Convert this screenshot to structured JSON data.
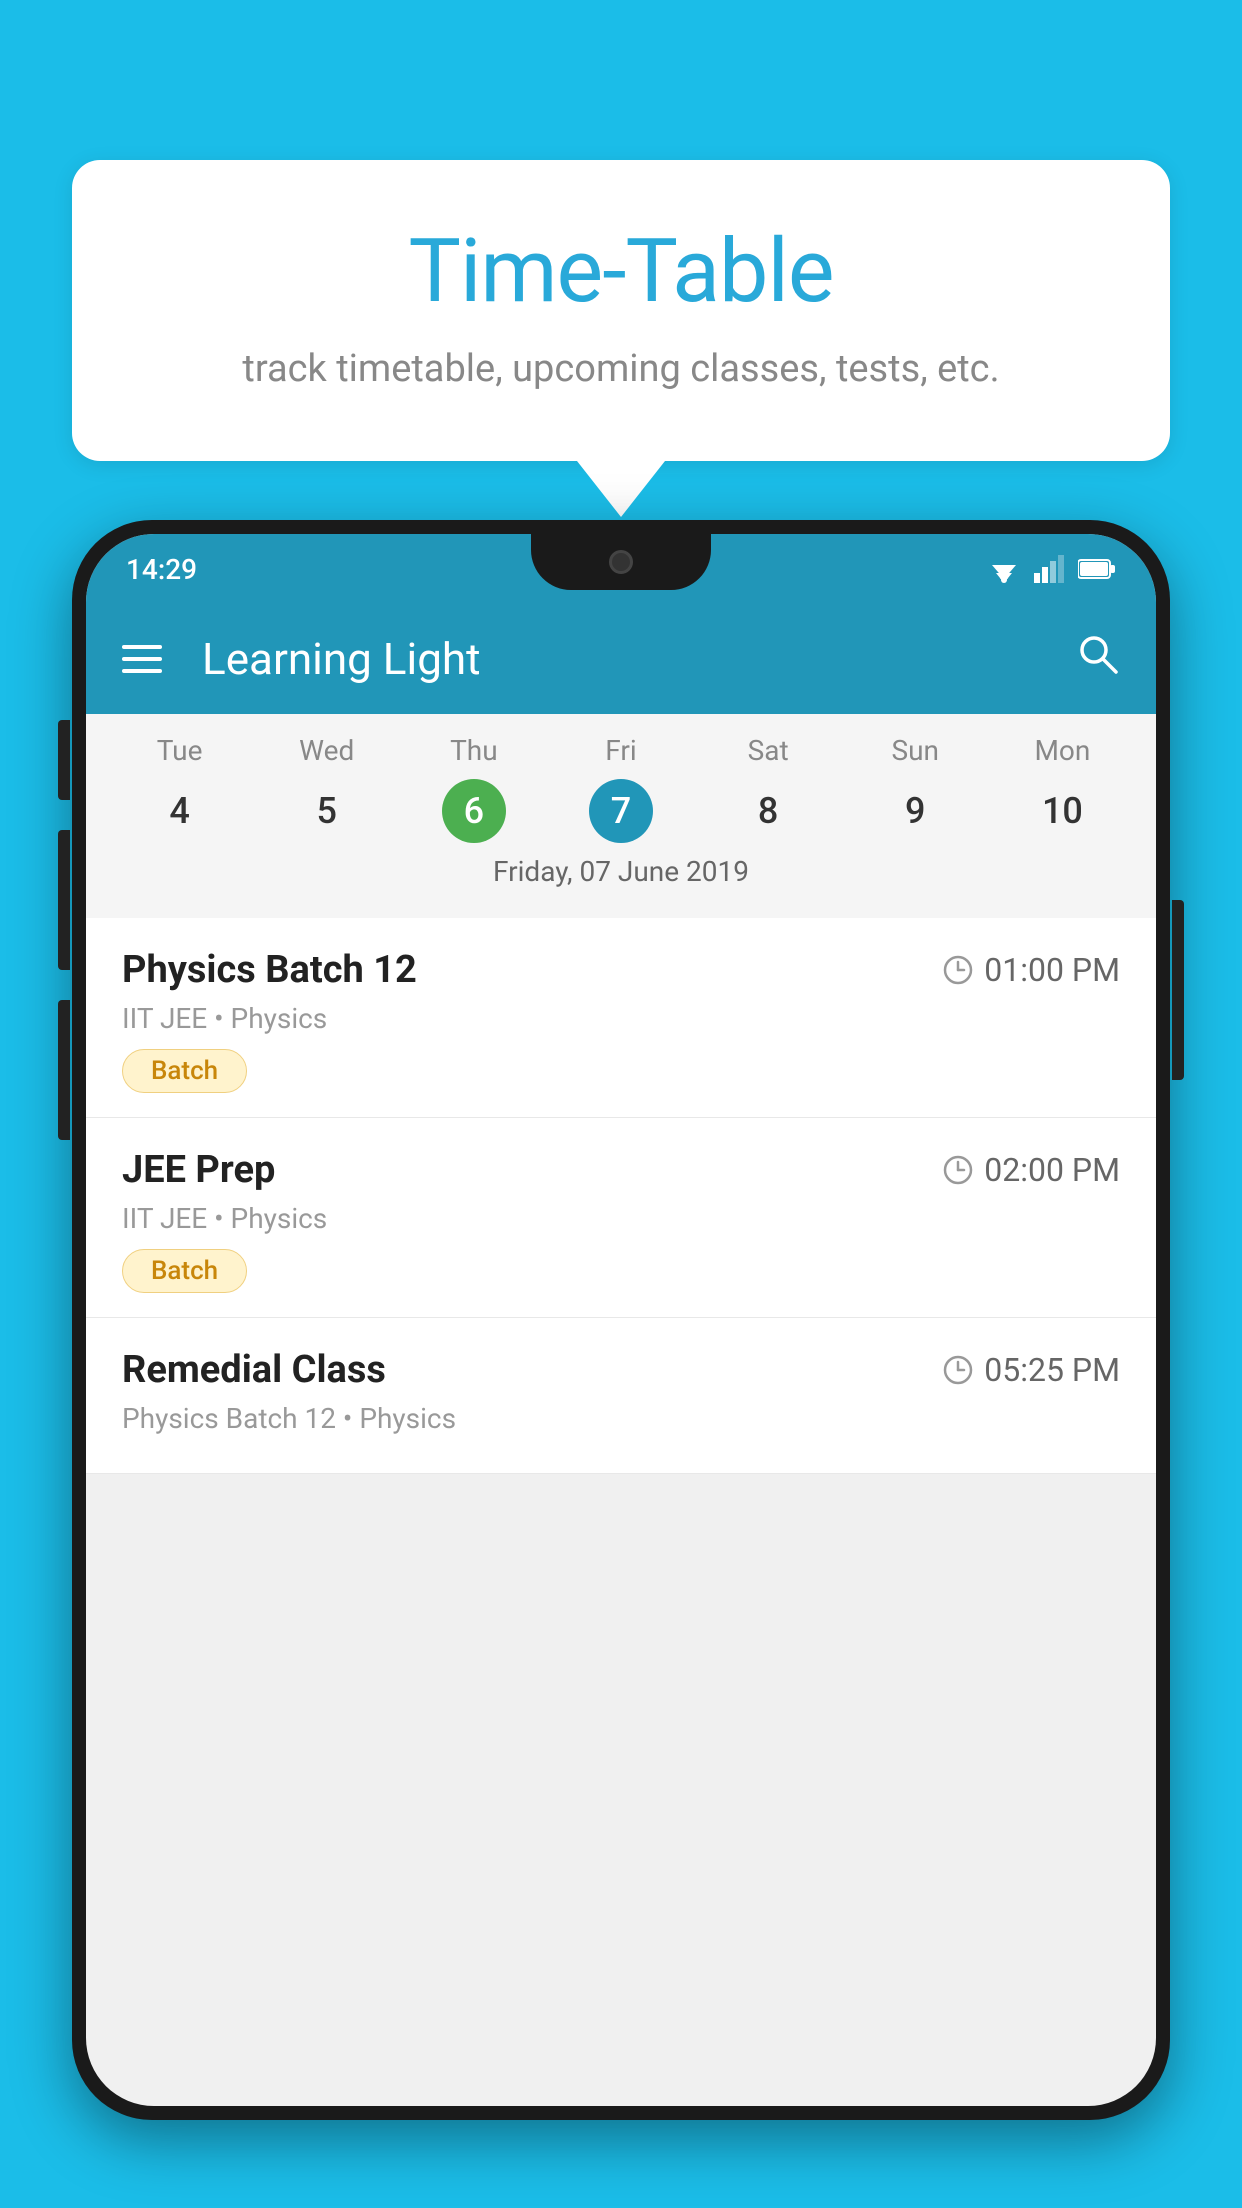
{
  "background": {
    "color": "#1BBDE8"
  },
  "speech_bubble": {
    "title": "Time-Table",
    "subtitle": "track timetable, upcoming classes, tests, etc."
  },
  "phone": {
    "status_bar": {
      "time": "14:29"
    },
    "app_bar": {
      "title": "Learning Light"
    },
    "calendar": {
      "days": [
        {
          "name": "Tue",
          "num": "4",
          "state": "normal"
        },
        {
          "name": "Wed",
          "num": "5",
          "state": "normal"
        },
        {
          "name": "Thu",
          "num": "6",
          "state": "today"
        },
        {
          "name": "Fri",
          "num": "7",
          "state": "selected"
        },
        {
          "name": "Sat",
          "num": "8",
          "state": "normal"
        },
        {
          "name": "Sun",
          "num": "9",
          "state": "normal"
        },
        {
          "name": "Mon",
          "num": "10",
          "state": "normal"
        }
      ],
      "selected_date_label": "Friday, 07 June 2019"
    },
    "schedule": [
      {
        "title": "Physics Batch 12",
        "time": "01:00 PM",
        "subtitle": "IIT JEE • Physics",
        "badge": "Batch"
      },
      {
        "title": "JEE Prep",
        "time": "02:00 PM",
        "subtitle": "IIT JEE • Physics",
        "badge": "Batch"
      },
      {
        "title": "Remedial Class",
        "time": "05:25 PM",
        "subtitle": "Physics Batch 12 • Physics",
        "badge": null
      }
    ]
  }
}
